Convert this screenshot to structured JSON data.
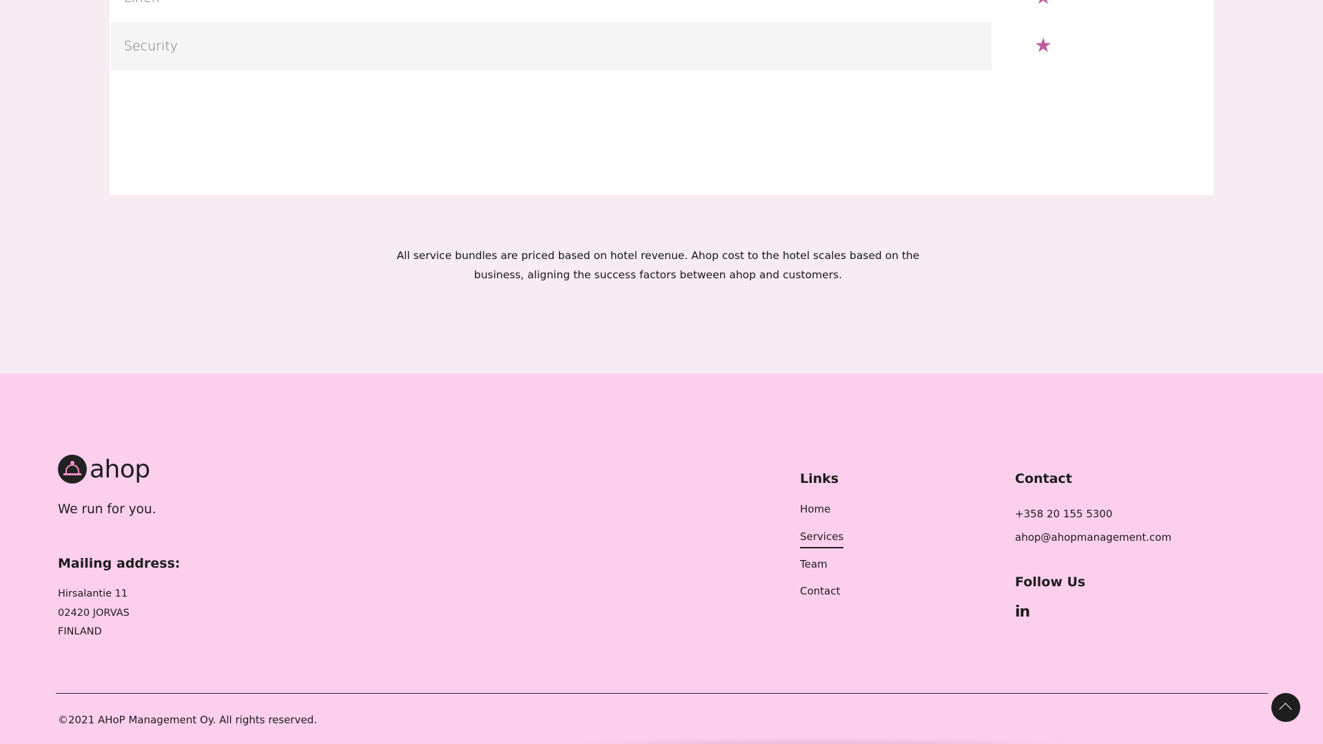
{
  "services_table": {
    "rows": [
      {
        "label": "Linen",
        "icon": "star-icon"
      },
      {
        "label": "Security",
        "icon": "star-icon"
      }
    ],
    "star_color": "#c05a9e"
  },
  "pricing_note": {
    "line1": "All service bundles are priced based on hotel revenue. Ahop cost to the hotel scales based on the",
    "line2": "business, aligning the success factors between ahop and customers."
  },
  "footer": {
    "background": "#fccfed",
    "logo_text": "ahop",
    "tagline": "We run for you.",
    "mailing": {
      "heading": "Mailing address:",
      "lines": [
        "Hirsalantie 11",
        "02420 JORVAS",
        "FINLAND"
      ]
    },
    "links": {
      "heading": "Links",
      "items": [
        "Home",
        "Services",
        "Team",
        "Contact"
      ],
      "active": "Services"
    },
    "contact": {
      "heading": "Contact",
      "phone": "+358 20 155 5300",
      "email": "ahop@ahopmanagement.com"
    },
    "follow": {
      "heading": "Follow Us",
      "linkedin": "in"
    },
    "copyright": "©2021 AHoP Management Oy. All rights reserved."
  }
}
